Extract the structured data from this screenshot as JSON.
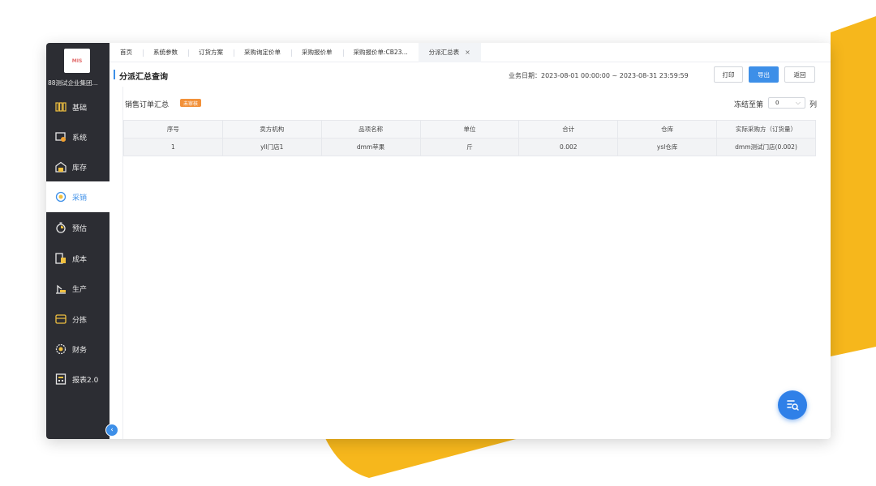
{
  "app": {
    "logo_text": "MIS",
    "company": "88测试企业集团..."
  },
  "sidebar": {
    "items": [
      {
        "label": "基础",
        "icon": "database-icon"
      },
      {
        "label": "系统",
        "icon": "system-icon"
      },
      {
        "label": "库存",
        "icon": "warehouse-icon"
      },
      {
        "label": "采销",
        "icon": "purchase-sales-icon",
        "active": true
      },
      {
        "label": "预估",
        "icon": "stopwatch-icon"
      },
      {
        "label": "成本",
        "icon": "ledger-icon"
      },
      {
        "label": "生产",
        "icon": "production-icon"
      },
      {
        "label": "分拣",
        "icon": "sorting-icon"
      },
      {
        "label": "财务",
        "icon": "finance-icon"
      },
      {
        "label": "报表2.0",
        "icon": "report-icon"
      }
    ]
  },
  "tabs": [
    {
      "label": "首页"
    },
    {
      "label": "系统参数"
    },
    {
      "label": "订货方案"
    },
    {
      "label": "采购询定价单"
    },
    {
      "label": "采购报价单"
    },
    {
      "label": "采购报价单:CB23..."
    },
    {
      "label": "分派汇总表",
      "active": true,
      "close": "×"
    }
  ],
  "header": {
    "title": "分派汇总查询",
    "biz_date": "业务日期：2023-08-01 00:00:00 ~ 2023-08-31 23:59:59",
    "print_label": "打印",
    "export_label": "导出",
    "back_label": "返回"
  },
  "summary": {
    "title": "销售订单汇总",
    "badge": "未审核",
    "freeze_label": "冻结至第",
    "freeze_value": "0",
    "freeze_suffix": "列"
  },
  "table": {
    "columns": [
      "序号",
      "卖方机构",
      "品项名称",
      "单位",
      "合计",
      "仓库",
      "实际采购方（订货量）"
    ],
    "rows": [
      [
        "1",
        "yll门店1",
        "dmm苹果",
        "斤",
        "0.002",
        "ysl仓库",
        "dmm测试门店(0.002)"
      ]
    ]
  },
  "colors": {
    "accent": "#3d8fe8",
    "sidebar_bg": "#2c2d33",
    "badge": "#f2913a",
    "deco_yellow": "#f6b71c"
  }
}
